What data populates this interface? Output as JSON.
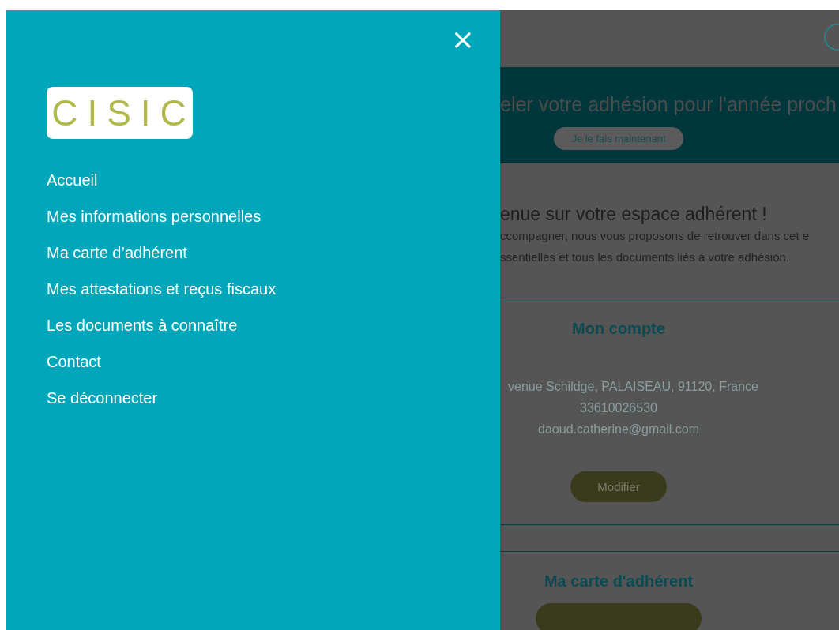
{
  "drawer": {
    "close_icon": "×",
    "logo": "CISIC",
    "menu": [
      {
        "label": "Accueil"
      },
      {
        "label": "Mes informations personnelles"
      },
      {
        "label": "Ma carte d’adhérent"
      },
      {
        "label": "Mes attestations et reçus fiscaux"
      },
      {
        "label": "Les documents à connaître"
      },
      {
        "label": "Contact"
      },
      {
        "label": "Se déconnecter"
      }
    ]
  },
  "background_page": {
    "banner": {
      "text": "eler votre adhésion pour l'année proch",
      "button": "Je le fais maintenant"
    },
    "welcome": {
      "heading": "enue sur votre espace adhérent !",
      "lines": [
        "ccompagner, nous vous proposons de retrouver dans cet e",
        "ssentielles et tous les documents liés à votre adhésion."
      ]
    },
    "account": {
      "title": "Mon compte",
      "address": "venue Schildge, PALAISEAU, 91120, France",
      "phone": "33610026530",
      "email": "daoud.catherine@gmail.com",
      "button": "Modifier"
    },
    "card": {
      "title": "Ma carte d'adhérent"
    }
  }
}
